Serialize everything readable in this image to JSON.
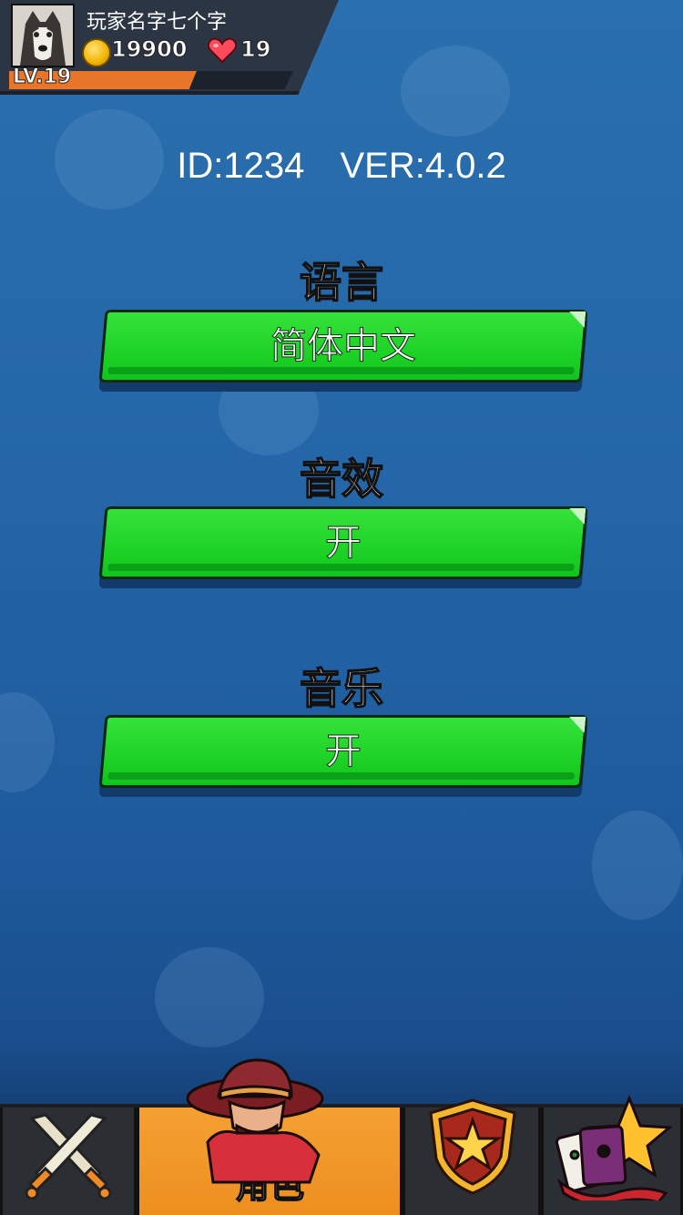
{
  "player": {
    "name": "玩家名字七个字",
    "coins": "19900",
    "lives": "19",
    "level": "LV.19",
    "xp_progress": 0.66
  },
  "info": {
    "id": "ID:1234",
    "version": "VER:4.0.2"
  },
  "settings": {
    "language": {
      "title": "语言",
      "value": "简体中文"
    },
    "sound": {
      "title": "音效",
      "value": "开"
    },
    "music": {
      "title": "音乐",
      "value": "开"
    }
  },
  "nav": {
    "tabs": [
      {
        "icon": "crossed-swords-icon",
        "label": ""
      },
      {
        "icon": "character-icon",
        "label": "角色",
        "active": true
      },
      {
        "icon": "star-shield-icon",
        "label": ""
      },
      {
        "icon": "cards-star-icon",
        "label": ""
      }
    ]
  },
  "colors": {
    "background": "#2466a8",
    "button_green": "#22d52a",
    "active_tab": "#f09422",
    "xp_fill": "#e8762a"
  }
}
